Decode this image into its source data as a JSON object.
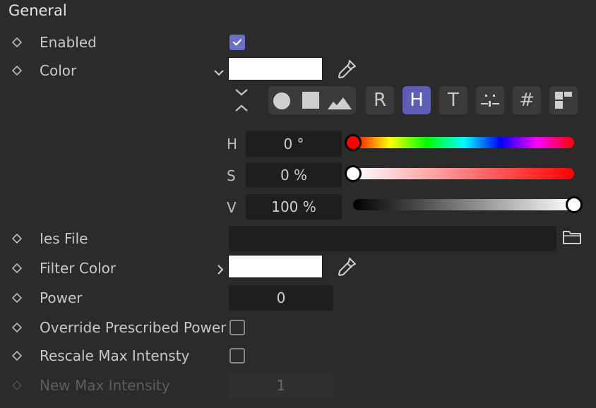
{
  "section": {
    "title": "General"
  },
  "enabled": {
    "label": "Enabled",
    "checked": true
  },
  "color": {
    "label": "Color",
    "value_hex": "#ffffff"
  },
  "color_modes": {
    "buttons": [
      "R",
      "H",
      "T",
      "#"
    ],
    "active": "H"
  },
  "hsv": {
    "h_label": "H",
    "h_value": "0 °",
    "h_fraction": 0.0,
    "s_label": "S",
    "s_value": "0 %",
    "s_fraction": 0.0,
    "v_label": "V",
    "v_value": "100 %",
    "v_fraction": 1.0
  },
  "ies_file": {
    "label": "Ies File",
    "value": ""
  },
  "filter_color": {
    "label": "Filter Color",
    "value_hex": "#ffffff"
  },
  "power": {
    "label": "Power",
    "value": "0"
  },
  "override_power": {
    "label": "Override Prescribed Power",
    "checked": false
  },
  "rescale": {
    "label": "Rescale Max Intensty",
    "checked": false
  },
  "new_max": {
    "label": "New Max Intensity",
    "value": "1"
  },
  "colors": {
    "accent": "#5b5fb5",
    "checkbox_accent": "#6b6fc6",
    "background": "#2b2b2b",
    "field": "#1e1e1e"
  }
}
